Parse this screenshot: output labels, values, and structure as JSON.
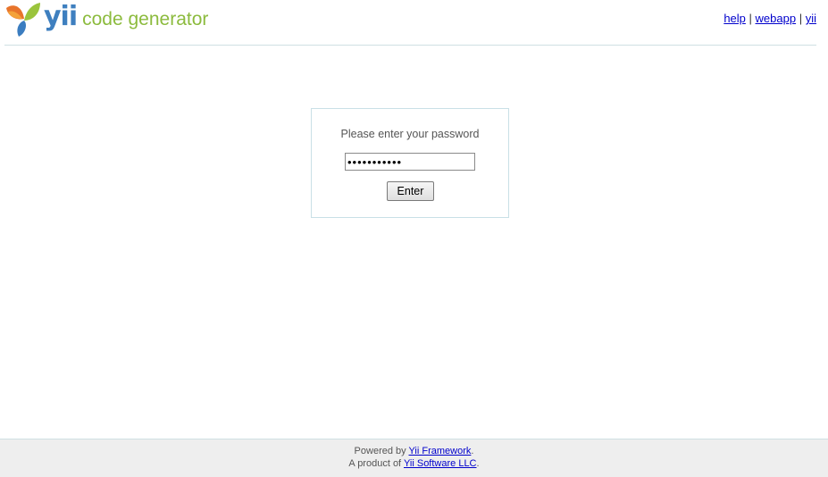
{
  "header": {
    "logo_mark": "yii",
    "logo_text": "code generator",
    "links": [
      {
        "label": "help"
      },
      {
        "label": "webapp"
      },
      {
        "label": "yii"
      }
    ],
    "separator": "|"
  },
  "login": {
    "prompt": "Please enter your password",
    "password_value": "•••••••••••",
    "submit_label": "Enter"
  },
  "footer": {
    "powered_prefix": "Powered by ",
    "powered_link": "Yii Framework",
    "powered_suffix": ".",
    "product_prefix": "A product of ",
    "product_link": "Yii Software LLC",
    "product_suffix": "."
  },
  "colors": {
    "link": "#0000cc",
    "logo_blue": "#3e7fbf",
    "logo_green": "#8cbb3e",
    "footer_bg": "#eeeeee"
  },
  "icons": [
    "yii-leaf-logo-icon"
  ]
}
